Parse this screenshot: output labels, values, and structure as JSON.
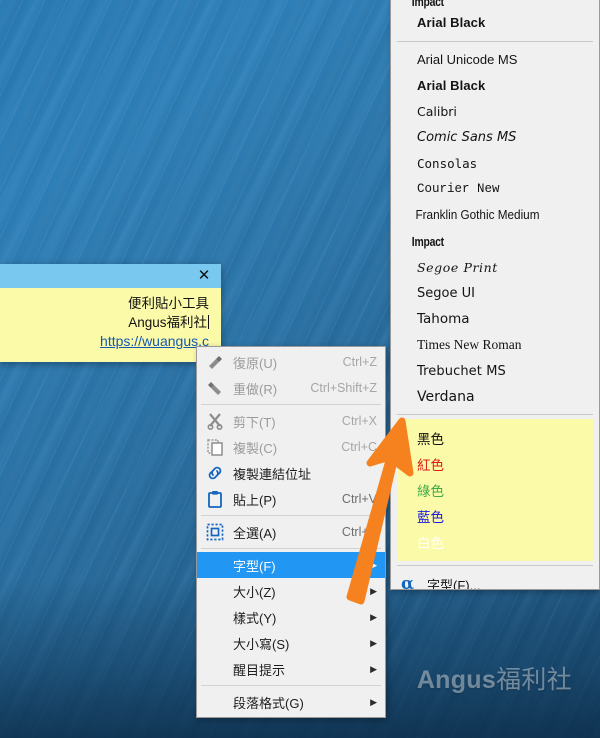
{
  "desktop": {
    "watermark_en": "Angus",
    "watermark_cn": "福利社"
  },
  "sticky_note": {
    "close_label": "✕",
    "line1": "便利貼小工具",
    "line2": "Angus福利社",
    "link": "https://wuangus.c"
  },
  "context_menu": {
    "items": [
      {
        "label": "復原(U)",
        "accel": "Ctrl+Z",
        "icon": "undo-icon",
        "state": "disabled",
        "submenu": false
      },
      {
        "label": "重做(R)",
        "accel": "Ctrl+Shift+Z",
        "icon": "redo-icon",
        "state": "disabled",
        "submenu": false
      },
      {
        "separator": true
      },
      {
        "label": "剪下(T)",
        "accel": "Ctrl+X",
        "icon": "scissors-icon",
        "state": "disabled",
        "submenu": false
      },
      {
        "label": "複製(C)",
        "accel": "Ctrl+C",
        "icon": "copy-icon",
        "state": "disabled",
        "submenu": false
      },
      {
        "label": "複製連結位址",
        "accel": "",
        "icon": "link-icon",
        "state": "normal",
        "submenu": false
      },
      {
        "label": "貼上(P)",
        "accel": "Ctrl+V",
        "icon": "clipboard-icon",
        "state": "normal",
        "submenu": false
      },
      {
        "separator": true
      },
      {
        "label": "全選(A)",
        "accel": "Ctrl+A",
        "icon": "select-all-icon",
        "state": "normal",
        "submenu": false
      },
      {
        "separator": true
      },
      {
        "label": "字型(F)",
        "accel": "",
        "icon": "",
        "state": "highlighted",
        "submenu": true
      },
      {
        "label": "大小(Z)",
        "accel": "",
        "icon": "",
        "state": "normal",
        "submenu": true
      },
      {
        "label": "樣式(Y)",
        "accel": "",
        "icon": "",
        "state": "normal",
        "submenu": true
      },
      {
        "label": "大小寫(S)",
        "accel": "",
        "icon": "",
        "state": "normal",
        "submenu": true
      },
      {
        "label": "醒目提示",
        "accel": "",
        "icon": "",
        "state": "normal",
        "submenu": true
      },
      {
        "separator": true
      },
      {
        "label": "段落格式(G)",
        "accel": "",
        "icon": "",
        "state": "normal",
        "submenu": true
      }
    ],
    "submenu_arrow": "▶"
  },
  "font_submenu": {
    "recent": [
      {
        "label": "Impact",
        "style": "ff-impact",
        "clipped": true
      },
      {
        "label": "Arial Black",
        "style": "ff-arial-black",
        "clipped": false
      }
    ],
    "fonts": [
      {
        "label": "Arial Unicode MS",
        "style": "ff-arial-uni"
      },
      {
        "label": "Arial Black",
        "style": "ff-arial-black"
      },
      {
        "label": "Calibri",
        "style": "ff-calibri"
      },
      {
        "label": "Comic Sans MS",
        "style": "ff-comic"
      },
      {
        "label": "Consolas",
        "style": "ff-consolas"
      },
      {
        "label": "Courier New",
        "style": "ff-courier"
      },
      {
        "label": "Franklin Gothic Medium",
        "style": "ff-franklin"
      },
      {
        "label": "Impact",
        "style": "ff-impact"
      },
      {
        "label": "Segoe Print",
        "style": "ff-segoe-print"
      },
      {
        "label": "Segoe UI",
        "style": "ff-segoe-ui"
      },
      {
        "label": "Tahoma",
        "style": "ff-tahoma"
      },
      {
        "label": "Times New Roman",
        "style": "ff-times"
      },
      {
        "label": "Trebuchet MS",
        "style": "ff-trebuchet"
      },
      {
        "label": "Verdana",
        "style": "ff-verdana"
      }
    ],
    "colors": [
      {
        "label": "黑色",
        "hex": "#141414"
      },
      {
        "label": "紅色",
        "hex": "#e01b1b"
      },
      {
        "label": "綠色",
        "hex": "#3faa46"
      },
      {
        "label": "藍色",
        "hex": "#1a1ae0"
      },
      {
        "label": "白色",
        "hex": "#ffffff"
      }
    ],
    "font_dialog_label": "字型(F)...",
    "alpha_icon": "α"
  },
  "annotation": {
    "arrow_color": "#f5821f"
  }
}
